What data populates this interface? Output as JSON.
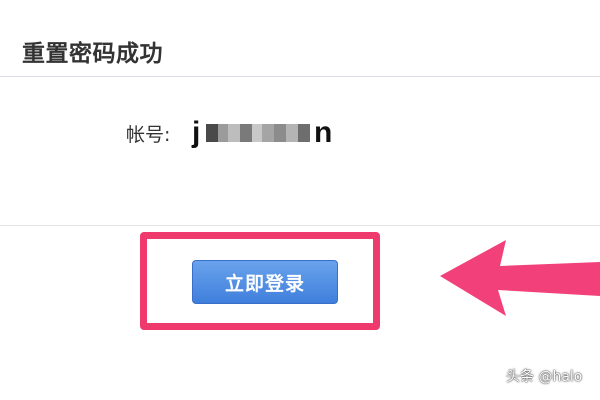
{
  "page": {
    "title": "重置密码成功"
  },
  "account": {
    "label": "帐号:",
    "value_first_char": "j",
    "value_last_char": "n",
    "value_redacted": true
  },
  "actions": {
    "login_now_label": "立即登录"
  },
  "annotation": {
    "highlight_color": "#ee3a6c",
    "arrow_color": "#f2407a"
  },
  "watermark": {
    "text": "头条 @halo"
  },
  "colors": {
    "button_top": "#6aa3ec",
    "button_bottom": "#3f7fdc",
    "divider": "#dcdde6"
  }
}
